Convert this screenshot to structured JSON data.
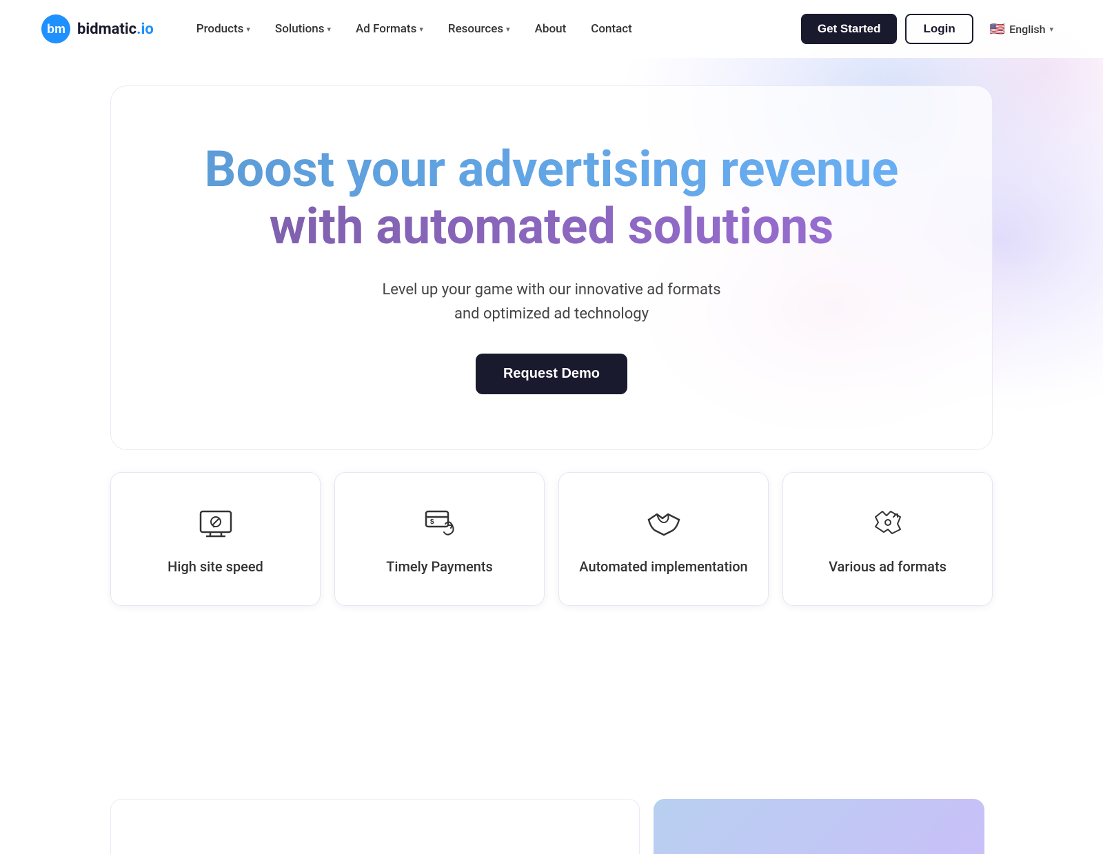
{
  "brand": {
    "logo_text_main": "bidmatic",
    "logo_text_tld": ".io",
    "logo_alt": "Bidmatic.io logo"
  },
  "nav": {
    "items": [
      {
        "label": "Products",
        "has_dropdown": true
      },
      {
        "label": "Solutions",
        "has_dropdown": true
      },
      {
        "label": "Ad Formats",
        "has_dropdown": true
      },
      {
        "label": "Resources",
        "has_dropdown": true
      },
      {
        "label": "About",
        "has_dropdown": false
      },
      {
        "label": "Contact",
        "has_dropdown": false
      }
    ],
    "cta_primary": "Get Started",
    "cta_secondary": "Login",
    "lang": "English"
  },
  "hero": {
    "title_line1": "Boost your advertising revenue",
    "title_line2": "with automated solutions",
    "subtitle_line1": "Level up your game with our innovative ad formats",
    "subtitle_line2": "and optimized ad technology",
    "cta_button": "Request Demo"
  },
  "features": [
    {
      "icon": "monitor-speed-icon",
      "label": "High site speed"
    },
    {
      "icon": "payment-icon",
      "label": "Timely Payments"
    },
    {
      "icon": "handshake-icon",
      "label": "Automated implementation"
    },
    {
      "icon": "ad-formats-icon",
      "label": "Various ad formats"
    }
  ]
}
